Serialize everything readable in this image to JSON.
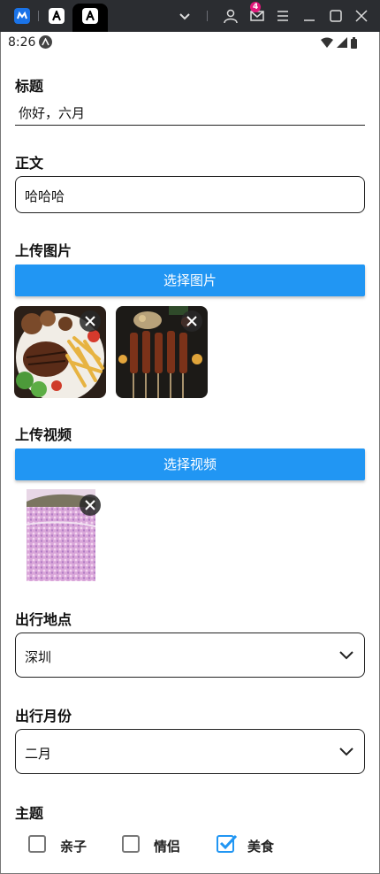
{
  "status_bar": {
    "time": "8:26"
  },
  "chrome": {
    "notification_count": "4"
  },
  "form": {
    "title_label": "标题",
    "title_value": "你好，六月",
    "body_label": "正文",
    "body_value": "哈哈哈",
    "upload_image_label": "上传图片",
    "choose_image_button": "选择图片",
    "upload_video_label": "上传视频",
    "choose_video_button": "选择视频",
    "location_label": "出行地点",
    "location_value": "深圳",
    "month_label": "出行月份",
    "month_value": "二月",
    "theme_label": "主题",
    "themes": [
      {
        "label": "亲子",
        "checked": false
      },
      {
        "label": "情侣",
        "checked": false
      },
      {
        "label": "美食",
        "checked": true
      }
    ]
  },
  "colors": {
    "accent": "#2196f3",
    "chrome_bg": "#2b2d31",
    "badge": "#e2177a"
  }
}
